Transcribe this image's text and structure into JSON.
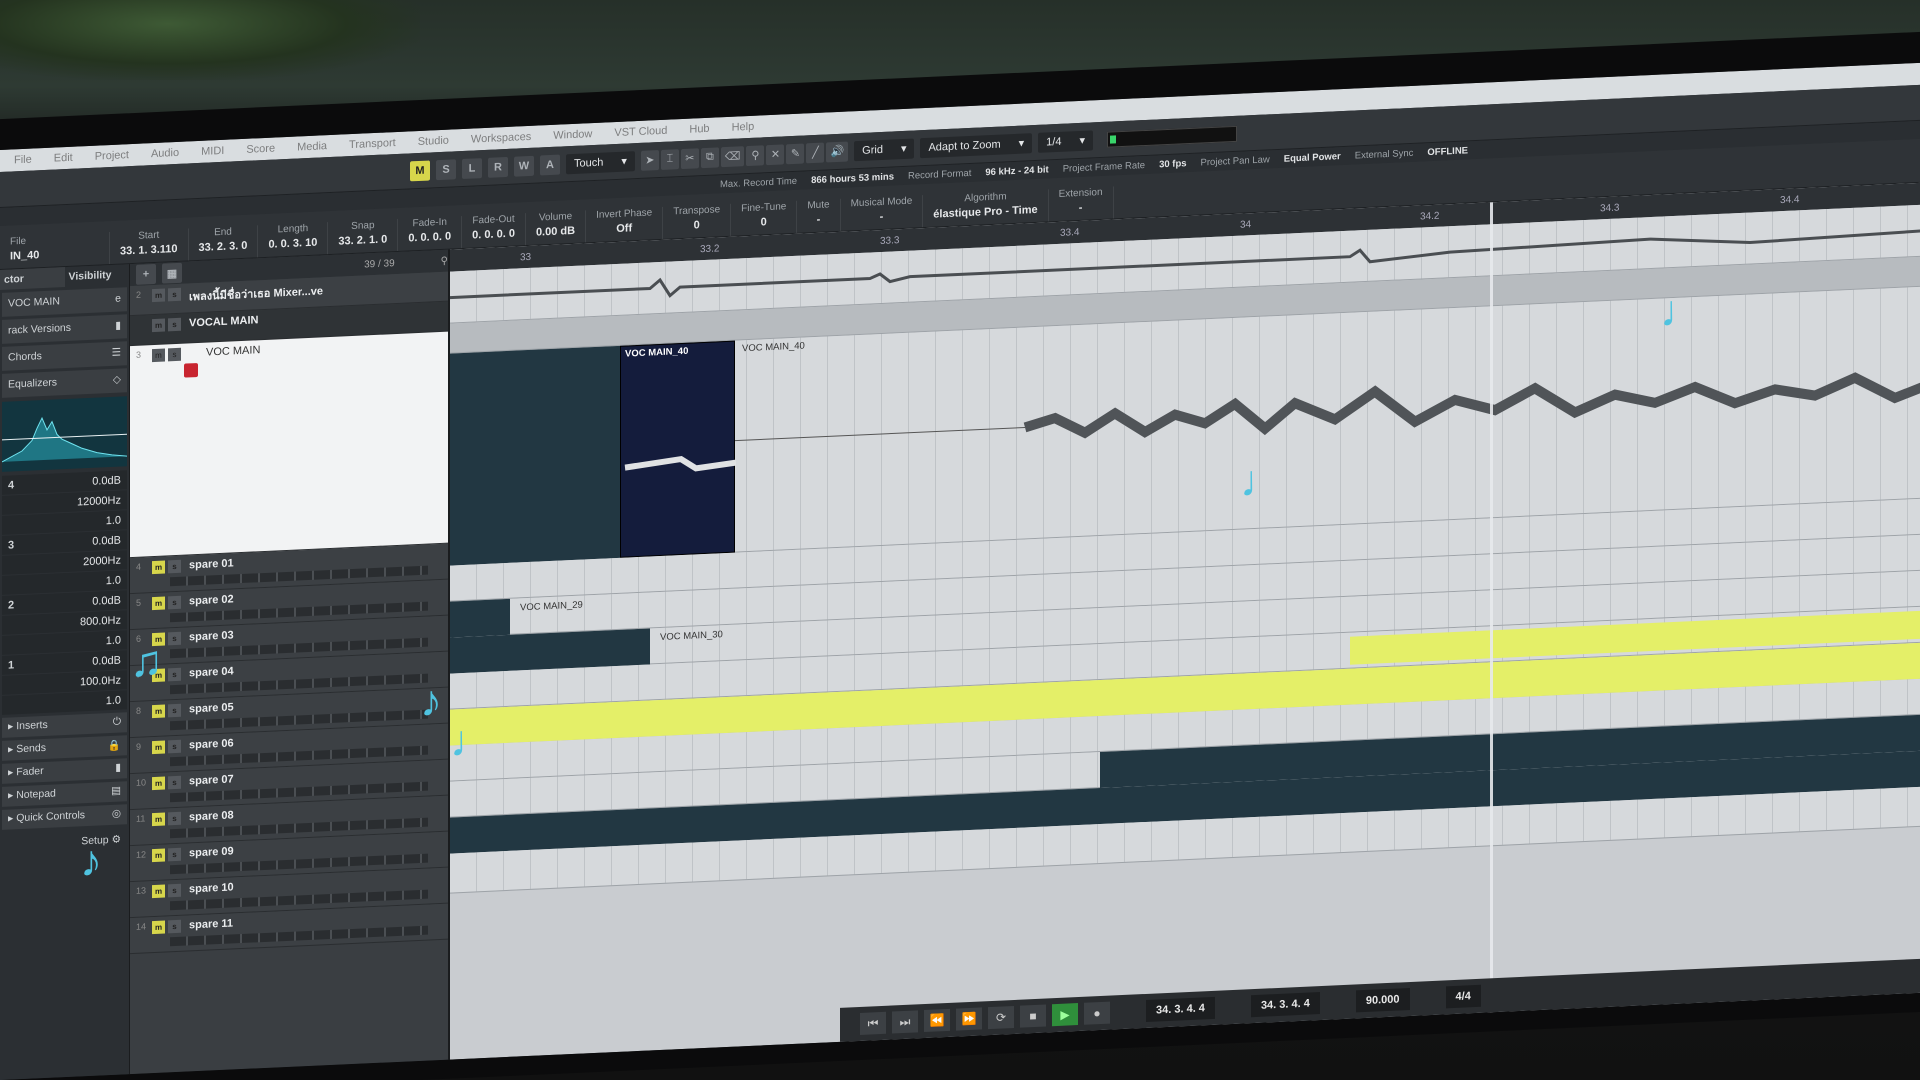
{
  "menu": [
    "File",
    "Edit",
    "Project",
    "Audio",
    "MIDI",
    "Score",
    "Media",
    "Transport",
    "Studio",
    "Workspaces",
    "Window",
    "VST Cloud",
    "Hub",
    "Help"
  ],
  "toolbar": {
    "m": "M",
    "s": "S",
    "l": "L",
    "r": "R",
    "w": "W",
    "a": "A",
    "automation_mode": "Touch",
    "snap_type": "Grid",
    "grid_type": "Adapt to Zoom",
    "quantize": "1/4"
  },
  "record_info": {
    "max_record_time_label": "Max. Record Time",
    "max_record_time": "866 hours 53 mins",
    "record_format_label": "Record Format",
    "record_format": "96 kHz - 24 bit",
    "frame_rate_label": "Project Frame Rate",
    "frame_rate": "30 fps",
    "pan_law_label": "Project Pan Law",
    "pan_law": "Equal Power",
    "external_sync_label": "External Sync",
    "external_sync": "OFFLINE"
  },
  "infoline": {
    "file_label": "File",
    "file": "IN_40",
    "start_label": "Start",
    "start": "33. 1. 3.110",
    "end_label": "End",
    "end": "33. 2. 3.  0",
    "length_label": "Length",
    "length": "0. 0. 3. 10",
    "snap_label": "Snap",
    "snap": "33. 2. 1.  0",
    "fadein_label": "Fade-In",
    "fadein": "0. 0. 0.  0",
    "fadeout_label": "Fade-Out",
    "fadeout": "0. 0. 0.  0",
    "volume_label": "Volume",
    "volume": "0.00",
    "volume_unit": "dB",
    "invert_label": "Invert Phase",
    "invert": "Off",
    "transpose_label": "Transpose",
    "transpose": "0",
    "finetune_label": "Fine-Tune",
    "finetune": "0",
    "mute_label": "Mute",
    "mute": "-",
    "musical_label": "Musical Mode",
    "musical": "-",
    "algorithm_label": "Algorithm",
    "algorithm": "élastique Pro - Time",
    "extension_label": "Extension",
    "extension": "-"
  },
  "inspector": {
    "tab1": "ctor",
    "tab2": "Visibility",
    "track_name": "VOC MAIN",
    "track_versions": "rack Versions",
    "chords": "Chords",
    "equalizers": "Equalizers",
    "eq": [
      {
        "band": "4",
        "gain": "0.0dB",
        "freq": "12000Hz",
        "q": "1.0"
      },
      {
        "band": "3",
        "gain": "0.0dB",
        "freq": "2000Hz",
        "q": "1.0"
      },
      {
        "band": "2",
        "gain": "0.0dB",
        "freq": "800.0Hz",
        "q": "1.0"
      },
      {
        "band": "1",
        "gain": "0.0dB",
        "freq": "100.0Hz",
        "q": "1.0"
      }
    ],
    "inserts": "Inserts",
    "sends": "Sends",
    "fader": "Fader",
    "notepad": "Notepad",
    "quick_controls": "Quick Controls",
    "setup": "Setup"
  },
  "tracklist": {
    "count": "39 / 39",
    "tracks": [
      {
        "num": "2",
        "name": "เพลงนี้มีชื่อว่าเธอ Mixer...ve"
      },
      {
        "num": "",
        "name": "VOCAL MAIN"
      },
      {
        "num": "3",
        "name": "VOC MAIN"
      },
      {
        "num": "4",
        "name": "spare 01"
      },
      {
        "num": "5",
        "name": "spare 02"
      },
      {
        "num": "6",
        "name": "spare 03"
      },
      {
        "num": "7",
        "name": "spare 04"
      },
      {
        "num": "8",
        "name": "spare 05"
      },
      {
        "num": "9",
        "name": "spare 06"
      },
      {
        "num": "10",
        "name": "spare 07"
      },
      {
        "num": "11",
        "name": "spare 08"
      },
      {
        "num": "12",
        "name": "spare 09"
      },
      {
        "num": "13",
        "name": "spare 10"
      },
      {
        "num": "14",
        "name": "spare 11"
      }
    ]
  },
  "ruler": [
    "33",
    "33.2",
    "33.3",
    "33.4",
    "34",
    "34.2",
    "34.3",
    "34.4"
  ],
  "events": {
    "selected": "VOC MAIN_40",
    "next": "VOC MAIN_40",
    "spare_a": "VOC MAIN_29",
    "spare_b": "VOC MAIN_30"
  },
  "transport": {
    "left_locator": "34. 3. 4.  4",
    "right_locator": "34. 3. 4.  4",
    "tempo": "90.000",
    "signature": "4/4"
  },
  "colors": {
    "accent_yellow": "#e4ef68",
    "selected_event": "#141c3c",
    "note_overlay": "#4fc3e0",
    "play_green": "#2f8f3b"
  }
}
